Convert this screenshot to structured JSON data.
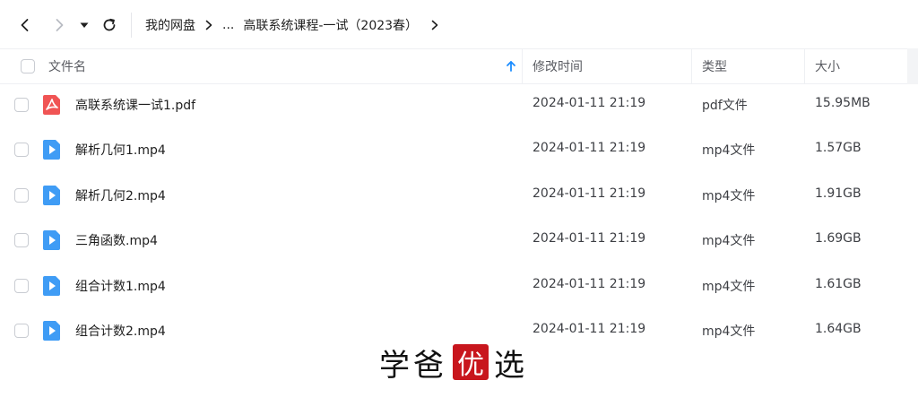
{
  "breadcrumb": {
    "root": "我的网盘",
    "ellipsis": "...",
    "current": "高联系统课程-一试（2023春）"
  },
  "table": {
    "headers": {
      "name": "文件名",
      "mtime": "修改时间",
      "type": "类型",
      "size": "大小"
    },
    "sort_icon": "arrow-up-icon",
    "rows": [
      {
        "icon": "pdf-file-icon",
        "name": "高联系统课一试1.pdf",
        "mtime": "2024-01-11 21:19",
        "type": "pdf文件",
        "size": "15.95MB"
      },
      {
        "icon": "video-file-icon",
        "name": "解析几何1.mp4",
        "mtime": "2024-01-11 21:19",
        "type": "mp4文件",
        "size": "1.57GB"
      },
      {
        "icon": "video-file-icon",
        "name": "解析几何2.mp4",
        "mtime": "2024-01-11 21:19",
        "type": "mp4文件",
        "size": "1.91GB"
      },
      {
        "icon": "video-file-icon",
        "name": "三角函数.mp4",
        "mtime": "2024-01-11 21:19",
        "type": "mp4文件",
        "size": "1.69GB"
      },
      {
        "icon": "video-file-icon",
        "name": "组合计数1.mp4",
        "mtime": "2024-01-11 21:19",
        "type": "mp4文件",
        "size": "1.61GB"
      },
      {
        "icon": "video-file-icon",
        "name": "组合计数2.mp4",
        "mtime": "2024-01-11 21:19",
        "type": "mp4文件",
        "size": "1.64GB"
      }
    ]
  },
  "watermark": {
    "chars": [
      "学",
      "爸",
      "优",
      "选"
    ]
  },
  "colors": {
    "accent": "#1a8cff",
    "pdf": "#f05454",
    "video": "#3f9cf5",
    "seal": "#c8161d"
  }
}
